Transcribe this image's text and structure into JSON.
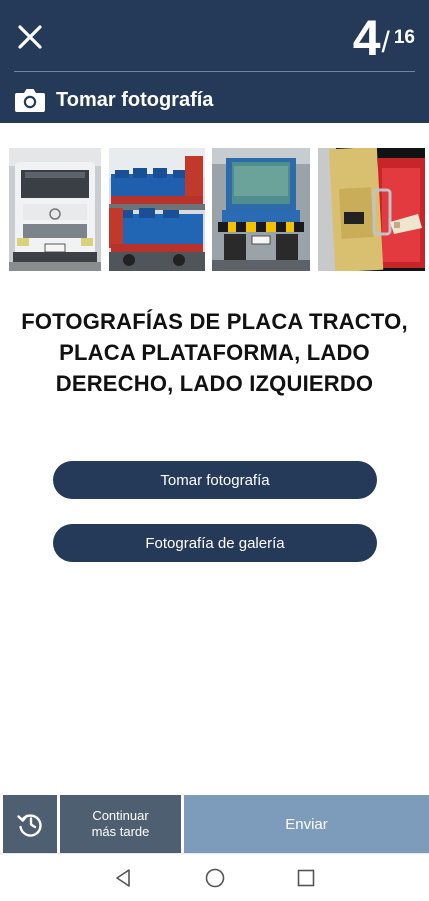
{
  "header": {
    "counter_current": "4",
    "counter_separator": "/",
    "counter_total": "16",
    "subtitle": "Tomar fotografía"
  },
  "thumbnails": [
    {
      "name": "thumb-truck-front"
    },
    {
      "name": "thumb-trailer-side"
    },
    {
      "name": "thumb-truck-rear"
    },
    {
      "name": "thumb-strap-closeup"
    }
  ],
  "instructions": "FOTOGRAFÍAS DE PLACA TRACTO, PLACA PLATAFORMA, LADO DERECHO, LADO IZQUIERDO",
  "buttons": {
    "take_photo": "Tomar fotografía",
    "gallery": "Fotografía de galería"
  },
  "bottom_bar": {
    "continue_later": "Continuar más tarde",
    "send": "Enviar"
  },
  "colors": {
    "primary": "#253a58",
    "send": "#7d9cbb",
    "secondary": "#4f5f72"
  },
  "icons": {
    "close": "close-icon",
    "camera": "camera-icon",
    "history": "history-icon"
  }
}
